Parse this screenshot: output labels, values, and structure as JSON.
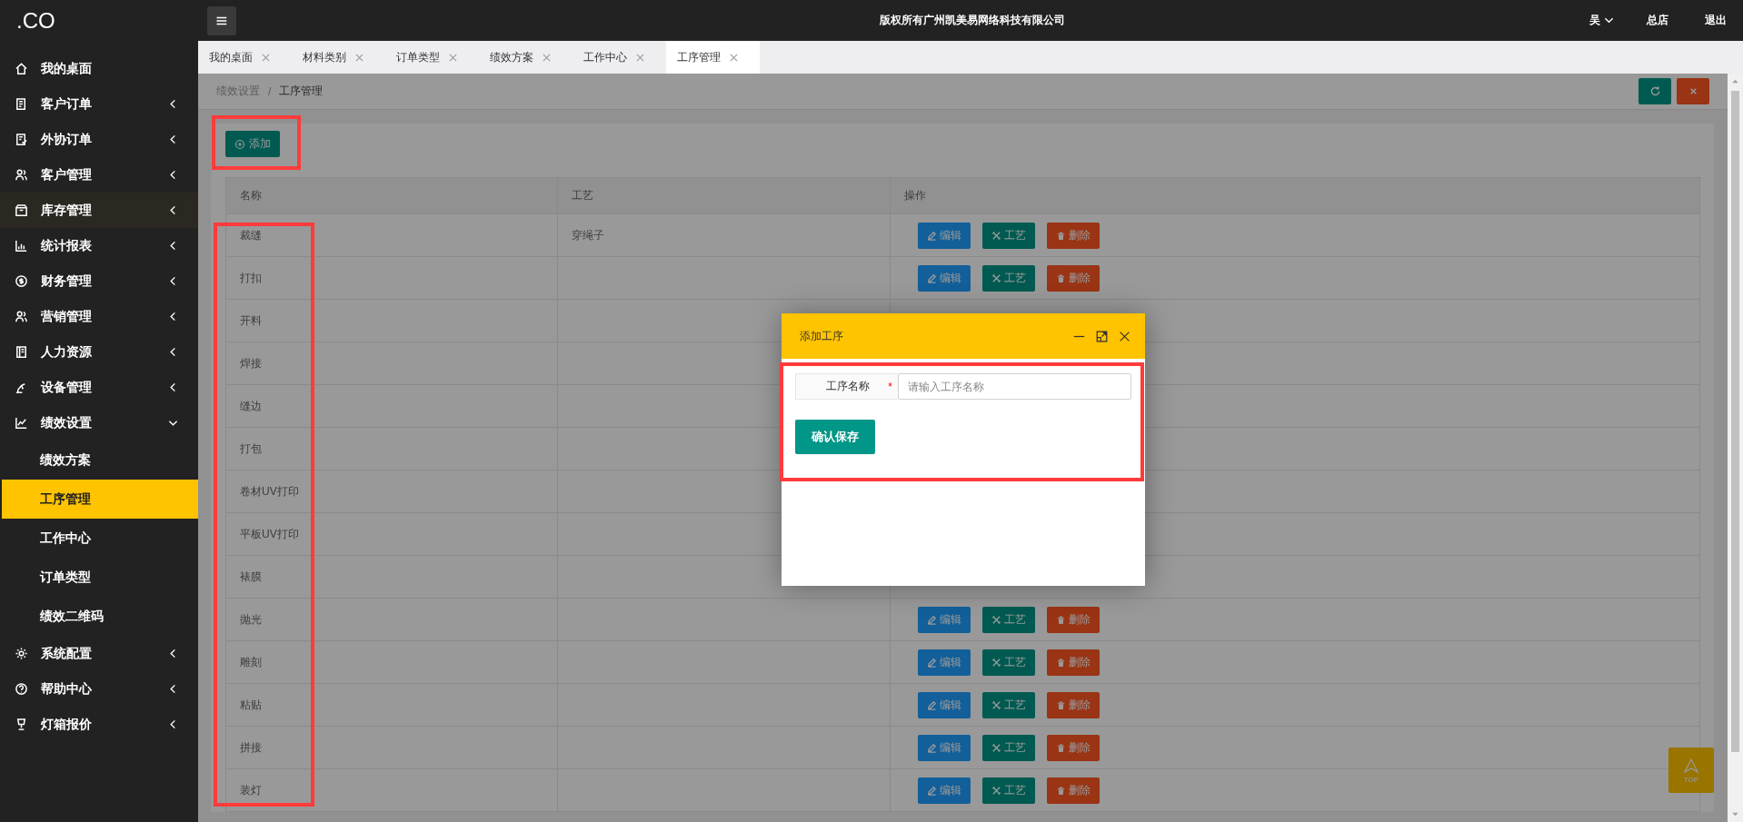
{
  "sidebar": {
    "logo": ".CO",
    "items": [
      {
        "label": "我的桌面"
      },
      {
        "label": "客户订单",
        "expanded": false
      },
      {
        "label": "外协订单",
        "expanded": false
      },
      {
        "label": "客户管理",
        "expanded": false
      },
      {
        "label": "库存管理",
        "expanded": false
      },
      {
        "label": "统计报表",
        "expanded": false
      },
      {
        "label": "财务管理",
        "expanded": false
      },
      {
        "label": "营销管理",
        "expanded": false
      },
      {
        "label": "人力资源",
        "expanded": false
      },
      {
        "label": "设备管理",
        "expanded": false
      },
      {
        "label": "绩效设置",
        "expanded": true,
        "children": [
          {
            "label": "绩效方案",
            "selected": false
          },
          {
            "label": "工序管理",
            "selected": true
          },
          {
            "label": "工作中心",
            "selected": false
          },
          {
            "label": "订单类型",
            "selected": false
          },
          {
            "label": "绩效二维码",
            "selected": false
          }
        ]
      },
      {
        "label": "系统配置",
        "expanded": false
      },
      {
        "label": "帮助中心",
        "expanded": false
      },
      {
        "label": "灯箱报价",
        "expanded": false
      }
    ]
  },
  "topbar": {
    "title": "版权所有广州凯美易网络科技有限公司",
    "user": "吴",
    "store": "总店",
    "logout": "退出"
  },
  "tabs": [
    {
      "label": "我的桌面",
      "selected": false
    },
    {
      "label": "材料类别",
      "selected": false
    },
    {
      "label": "订单类型",
      "selected": false
    },
    {
      "label": "绩效方案",
      "selected": false
    },
    {
      "label": "工作中心",
      "selected": false
    },
    {
      "label": "工序管理",
      "selected": true
    }
  ],
  "breadcrumb": {
    "items": [
      "绩效设置",
      "工序管理"
    ],
    "separator": "/"
  },
  "add_button": "添加",
  "table": {
    "columns": [
      "名称",
      "工艺",
      "操作"
    ],
    "rows": [
      {
        "name": "裁缝",
        "craft": "穿绳子",
        "actions": [
          {
            "kind": "edit",
            "label": "编辑"
          },
          {
            "kind": "craft",
            "label": "工艺"
          },
          {
            "kind": "delete",
            "label": "删除"
          }
        ]
      },
      {
        "name": "打扣",
        "actions": [
          {
            "kind": "edit",
            "label": "编辑"
          },
          {
            "kind": "craft",
            "label": "工艺"
          },
          {
            "kind": "delete",
            "label": "删除"
          }
        ]
      },
      {
        "name": "开料"
      },
      {
        "name": "焊接"
      },
      {
        "name": "缝边"
      },
      {
        "name": "打包"
      },
      {
        "name": "卷材UV打印"
      },
      {
        "name": "平板UV打印"
      },
      {
        "name": "裱膜"
      },
      {
        "name": "抛光",
        "actions": [
          {
            "kind": "edit",
            "label": "编辑"
          },
          {
            "kind": "craft",
            "label": "工艺"
          },
          {
            "kind": "delete",
            "label": "删除"
          }
        ]
      },
      {
        "name": "雕刻",
        "actions": [
          {
            "kind": "edit",
            "label": "编辑"
          },
          {
            "kind": "craft",
            "label": "工艺"
          },
          {
            "kind": "delete",
            "label": "删除"
          }
        ]
      },
      {
        "name": "粘贴",
        "actions": [
          {
            "kind": "edit",
            "label": "编辑"
          },
          {
            "kind": "craft",
            "label": "工艺"
          },
          {
            "kind": "delete",
            "label": "删除"
          }
        ]
      },
      {
        "name": "拼接",
        "actions": [
          {
            "kind": "edit",
            "label": "编辑"
          },
          {
            "kind": "craft",
            "label": "工艺"
          },
          {
            "kind": "delete",
            "label": "删除"
          }
        ]
      },
      {
        "name": "装灯",
        "actions": [
          {
            "kind": "edit",
            "label": "编辑"
          },
          {
            "kind": "craft",
            "label": "工艺"
          },
          {
            "kind": "delete",
            "label": "删除"
          }
        ]
      }
    ]
  },
  "back_to_top": "TOP",
  "modal": {
    "title": "添加工序",
    "field_label": "工序名称",
    "required_mark": "*",
    "placeholder": "请输入工序名称",
    "submit": "确认保存"
  }
}
